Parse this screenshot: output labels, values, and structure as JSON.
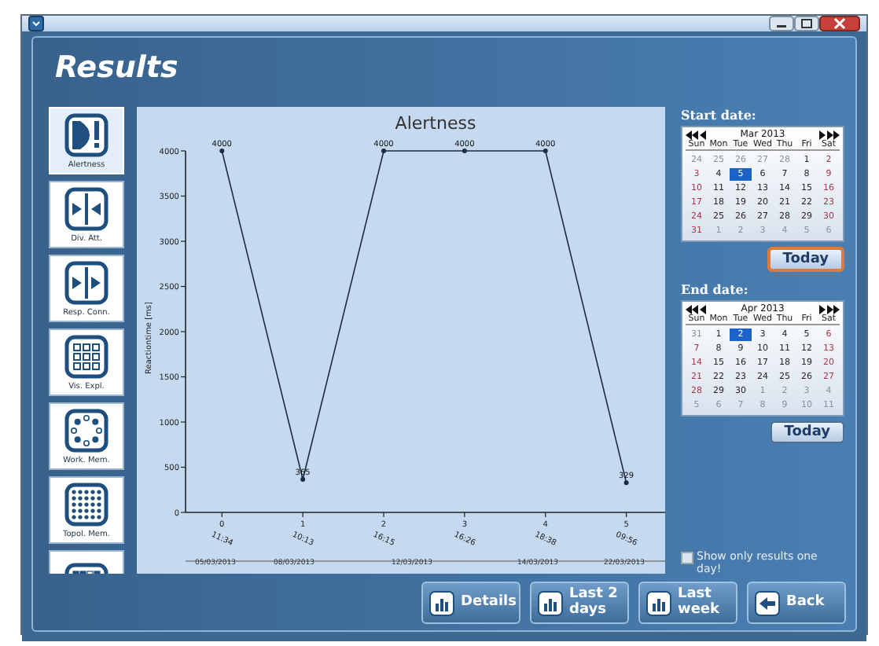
{
  "window": {
    "title": "Results"
  },
  "sidebar": {
    "items": [
      {
        "label": "Alertness",
        "kind": "alert",
        "selected": true
      },
      {
        "label": "Div. Att.",
        "kind": "split",
        "selected": false
      },
      {
        "label": "Resp. Conn.",
        "kind": "join",
        "selected": false
      },
      {
        "label": "Vis. Expl.",
        "kind": "grid",
        "selected": false
      },
      {
        "label": "Work. Mem.",
        "kind": "ring",
        "selected": false
      },
      {
        "label": "Topol. Mem.",
        "kind": "dots",
        "selected": false
      },
      {
        "kind": "squares",
        "selected": false
      }
    ]
  },
  "chart": {
    "chart_data": {
      "type": "line",
      "title": "Alertness",
      "ylabel": "Reactiontime [ms]",
      "x": [
        0,
        1,
        2,
        3,
        4,
        5
      ],
      "xticks": [
        {
          "value": 0,
          "label": "0"
        },
        {
          "value": 1,
          "label": "1"
        },
        {
          "value": 2,
          "label": "2"
        },
        {
          "value": 3,
          "label": "3"
        },
        {
          "value": 4,
          "label": "4"
        },
        {
          "value": 5,
          "label": "5"
        }
      ],
      "series": [
        {
          "color": "#1f2a44",
          "marker": "circle",
          "values": [
            4000,
            365,
            4000,
            4000,
            4000,
            329
          ]
        }
      ],
      "value_labels": [
        "4000",
        "365",
        "4000",
        "4000",
        "4000",
        "329"
      ],
      "xlim": [
        -0.45,
        5.48
      ],
      "ylim": [
        0,
        4000
      ],
      "yticks": [
        0,
        500,
        1000,
        1500,
        2000,
        2500,
        3000,
        3500,
        4000
      ],
      "data_labels": true
    },
    "time_labels": [
      "11:34",
      "10:13",
      "16:15",
      "16:26",
      "18:38",
      "09:56"
    ],
    "date_labels": [
      "05/03/2013",
      "08/03/2013",
      "12/03/2013",
      "14/03/2013",
      "22/03/2013"
    ]
  },
  "start_date": {
    "label": "Start date:",
    "month": "Mar 2013",
    "today_button": {
      "label": "Today",
      "focused": true
    },
    "weekdays": [
      "Sun",
      "Mon",
      "Tue",
      "Wed",
      "Thu",
      "Fri",
      "Sat"
    ],
    "days": [
      {
        "d": "24",
        "other": true,
        "selected": false
      },
      {
        "d": "25",
        "other": true,
        "selected": false
      },
      {
        "d": "26",
        "other": true,
        "selected": false
      },
      {
        "d": "27",
        "other": true,
        "selected": false
      },
      {
        "d": "28",
        "other": true,
        "selected": false
      },
      {
        "d": "1",
        "other": false,
        "selected": false
      },
      {
        "d": "2",
        "other": false,
        "selected": false
      },
      {
        "d": "3",
        "other": false,
        "selected": false
      },
      {
        "d": "4",
        "other": false,
        "selected": false
      },
      {
        "d": "5",
        "other": false,
        "selected": true
      },
      {
        "d": "6",
        "other": false,
        "selected": false
      },
      {
        "d": "7",
        "other": false,
        "selected": false
      },
      {
        "d": "8",
        "other": false,
        "selected": false
      },
      {
        "d": "9",
        "other": false,
        "selected": false
      },
      {
        "d": "10",
        "other": false,
        "selected": false
      },
      {
        "d": "11",
        "other": false,
        "selected": false
      },
      {
        "d": "12",
        "other": false,
        "selected": false
      },
      {
        "d": "13",
        "other": false,
        "selected": false
      },
      {
        "d": "14",
        "other": false,
        "selected": false
      },
      {
        "d": "15",
        "other": false,
        "selected": false
      },
      {
        "d": "16",
        "other": false,
        "selected": false
      },
      {
        "d": "17",
        "other": false,
        "selected": false
      },
      {
        "d": "18",
        "other": false,
        "selected": false
      },
      {
        "d": "19",
        "other": false,
        "selected": false
      },
      {
        "d": "20",
        "other": false,
        "selected": false
      },
      {
        "d": "21",
        "other": false,
        "selected": false
      },
      {
        "d": "22",
        "other": false,
        "selected": false
      },
      {
        "d": "23",
        "other": false,
        "selected": false
      },
      {
        "d": "24",
        "other": false,
        "selected": false
      },
      {
        "d": "25",
        "other": false,
        "selected": false
      },
      {
        "d": "26",
        "other": false,
        "selected": false
      },
      {
        "d": "27",
        "other": false,
        "selected": false
      },
      {
        "d": "28",
        "other": false,
        "selected": false
      },
      {
        "d": "29",
        "other": false,
        "selected": false
      },
      {
        "d": "30",
        "other": false,
        "selected": false
      },
      {
        "d": "31",
        "other": false,
        "selected": false
      },
      {
        "d": "1",
        "other": true,
        "selected": false
      },
      {
        "d": "2",
        "other": true,
        "selected": false
      },
      {
        "d": "3",
        "other": true,
        "selected": false
      },
      {
        "d": "4",
        "other": true,
        "selected": false
      },
      {
        "d": "5",
        "other": true,
        "selected": false
      },
      {
        "d": "6",
        "other": true,
        "selected": false
      }
    ]
  },
  "end_date": {
    "label": "End date:",
    "month": "Apr 2013",
    "today_button": {
      "label": "Today",
      "focused": false
    },
    "weekdays": [
      "Sun",
      "Mon",
      "Tue",
      "Wed",
      "Thu",
      "Fri",
      "Sat"
    ],
    "days": [
      {
        "d": "31",
        "other": true,
        "selected": false
      },
      {
        "d": "1",
        "other": false,
        "selected": false
      },
      {
        "d": "2",
        "other": false,
        "selected": true
      },
      {
        "d": "3",
        "other": false,
        "selected": false
      },
      {
        "d": "4",
        "other": false,
        "selected": false
      },
      {
        "d": "5",
        "other": false,
        "selected": false
      },
      {
        "d": "6",
        "other": false,
        "selected": false
      },
      {
        "d": "7",
        "other": false,
        "selected": false
      },
      {
        "d": "8",
        "other": false,
        "selected": false
      },
      {
        "d": "9",
        "other": false,
        "selected": false
      },
      {
        "d": "10",
        "other": false,
        "selected": false
      },
      {
        "d": "11",
        "other": false,
        "selected": false
      },
      {
        "d": "12",
        "other": false,
        "selected": false
      },
      {
        "d": "13",
        "other": false,
        "selected": false
      },
      {
        "d": "14",
        "other": false,
        "selected": false
      },
      {
        "d": "15",
        "other": false,
        "selected": false
      },
      {
        "d": "16",
        "other": false,
        "selected": false
      },
      {
        "d": "17",
        "other": false,
        "selected": false
      },
      {
        "d": "18",
        "other": false,
        "selected": false
      },
      {
        "d": "19",
        "other": false,
        "selected": false
      },
      {
        "d": "20",
        "other": false,
        "selected": false
      },
      {
        "d": "21",
        "other": false,
        "selected": false
      },
      {
        "d": "22",
        "other": false,
        "selected": false
      },
      {
        "d": "23",
        "other": false,
        "selected": false
      },
      {
        "d": "24",
        "other": false,
        "selected": false
      },
      {
        "d": "25",
        "other": false,
        "selected": false
      },
      {
        "d": "26",
        "other": false,
        "selected": false
      },
      {
        "d": "27",
        "other": false,
        "selected": false
      },
      {
        "d": "28",
        "other": false,
        "selected": false
      },
      {
        "d": "29",
        "other": false,
        "selected": false
      },
      {
        "d": "30",
        "other": false,
        "selected": false
      },
      {
        "d": "1",
        "other": true,
        "selected": false
      },
      {
        "d": "2",
        "other": true,
        "selected": false
      },
      {
        "d": "3",
        "other": true,
        "selected": false
      },
      {
        "d": "4",
        "other": true,
        "selected": false
      },
      {
        "d": "5",
        "other": true,
        "selected": false
      },
      {
        "d": "6",
        "other": true,
        "selected": false
      },
      {
        "d": "7",
        "other": true,
        "selected": false
      },
      {
        "d": "8",
        "other": true,
        "selected": false
      },
      {
        "d": "9",
        "other": true,
        "selected": false
      },
      {
        "d": "10",
        "other": true,
        "selected": false
      },
      {
        "d": "11",
        "other": true,
        "selected": false
      }
    ]
  },
  "one_day_checkbox": {
    "label": "Show only results one day!",
    "checked": false
  },
  "buttons": [
    {
      "label": "Details",
      "kind": "chart"
    },
    {
      "label": "Last 2 days",
      "kind": "chart"
    },
    {
      "label": "Last week",
      "kind": "chart"
    },
    {
      "label": "Back",
      "kind": "back"
    }
  ]
}
